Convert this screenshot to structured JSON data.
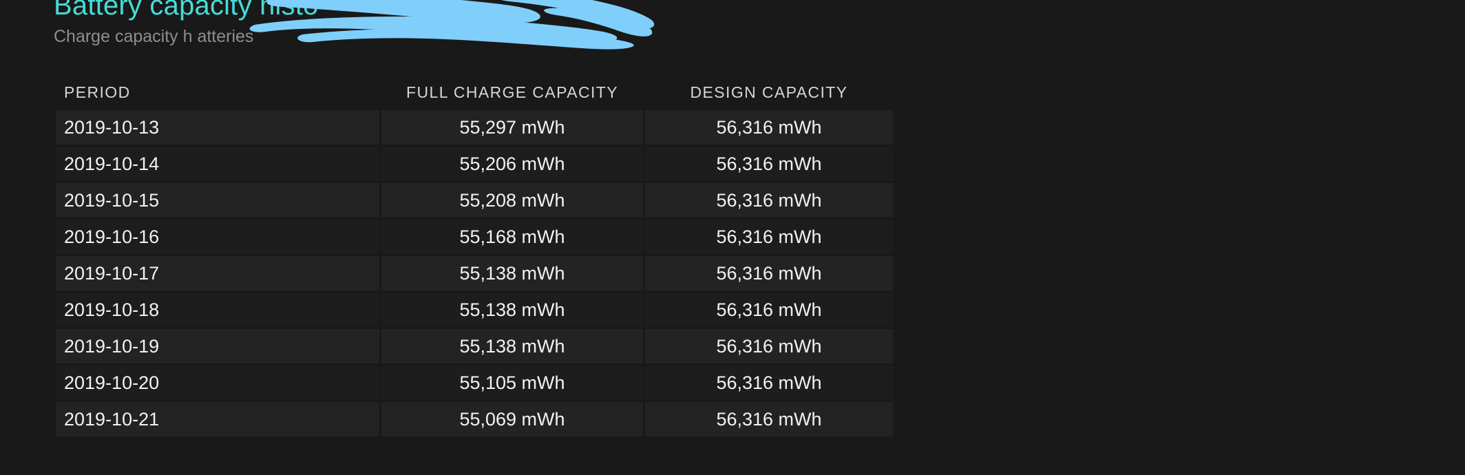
{
  "header": {
    "title": "Battery capacity histo",
    "subtitle": "Charge capacity h                    atteries"
  },
  "colors": {
    "title": "#46DCD8",
    "subtitle": "#8E8E8E",
    "page_background": "#191919",
    "row_odd": "#232323",
    "row_even": "#1D1D1D",
    "redaction": "#7FCFFA",
    "cell_text": "#F2F2F2",
    "header_text": "#D6D6D6"
  },
  "table": {
    "columns": [
      {
        "key": "period",
        "label": "PERIOD"
      },
      {
        "key": "full_charge_capacity",
        "label": "FULL CHARGE CAPACITY"
      },
      {
        "key": "design_capacity",
        "label": "DESIGN CAPACITY"
      }
    ],
    "rows": [
      {
        "period": "2019-10-13",
        "full_charge_capacity": "55,297 mWh",
        "design_capacity": "56,316 mWh"
      },
      {
        "period": "2019-10-14",
        "full_charge_capacity": "55,206 mWh",
        "design_capacity": "56,316 mWh"
      },
      {
        "period": "2019-10-15",
        "full_charge_capacity": "55,208 mWh",
        "design_capacity": "56,316 mWh"
      },
      {
        "period": "2019-10-16",
        "full_charge_capacity": "55,168 mWh",
        "design_capacity": "56,316 mWh"
      },
      {
        "period": "2019-10-17",
        "full_charge_capacity": "55,138 mWh",
        "design_capacity": "56,316 mWh"
      },
      {
        "period": "2019-10-18",
        "full_charge_capacity": "55,138 mWh",
        "design_capacity": "56,316 mWh"
      },
      {
        "period": "2019-10-19",
        "full_charge_capacity": "55,138 mWh",
        "design_capacity": "56,316 mWh"
      },
      {
        "period": "2019-10-20",
        "full_charge_capacity": "55,105 mWh",
        "design_capacity": "56,316 mWh"
      },
      {
        "period": "2019-10-21",
        "full_charge_capacity": "55,069 mWh",
        "design_capacity": "56,316 mWh"
      }
    ]
  },
  "annotation": {
    "kind": "redaction-scribble",
    "color": "#7FCFFA"
  }
}
